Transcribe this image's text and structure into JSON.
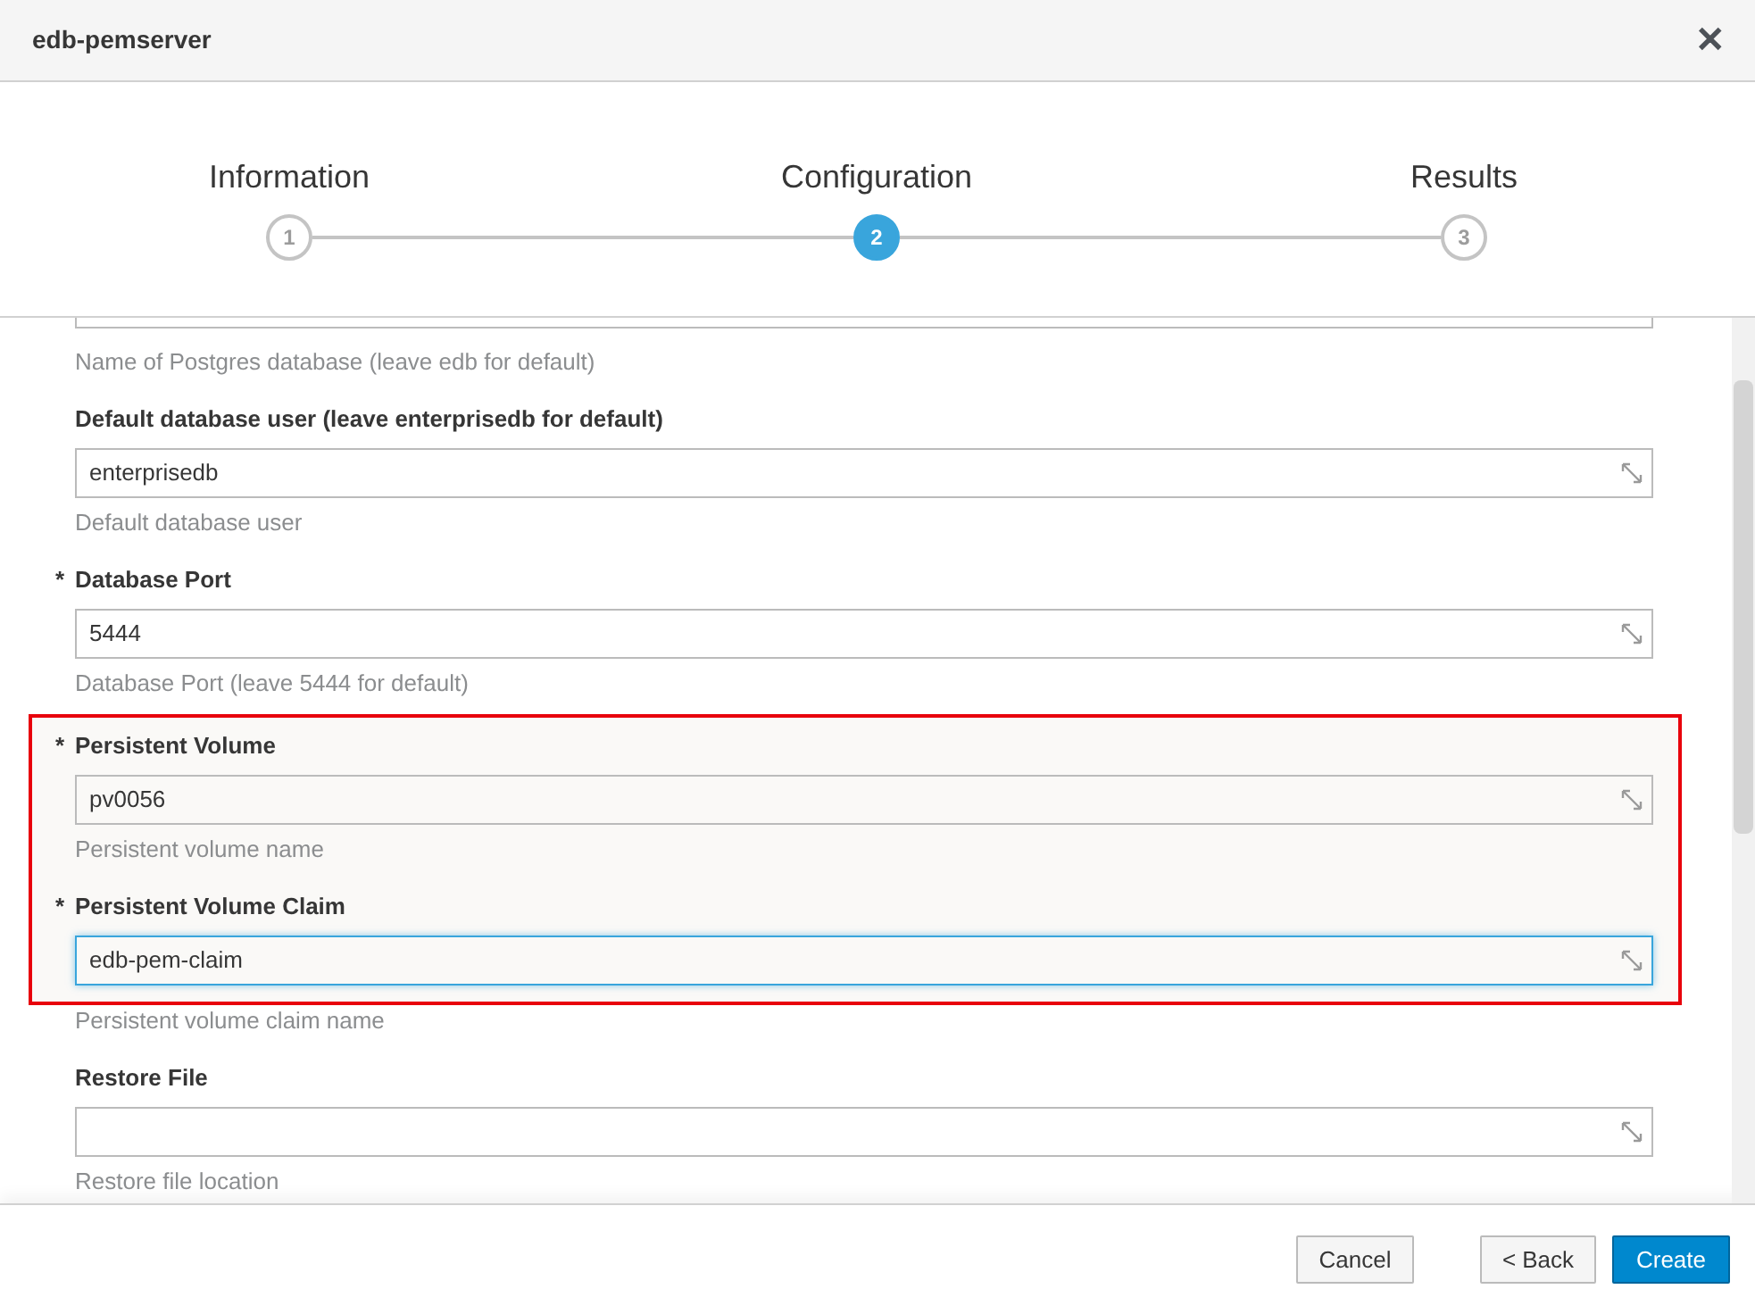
{
  "window": {
    "title": "edb-pemserver",
    "close": "✕"
  },
  "steps": [
    {
      "label": "Information",
      "number": "1",
      "selected": false
    },
    {
      "label": "Configuration",
      "number": "2",
      "selected": true
    },
    {
      "label": "Results",
      "number": "3",
      "selected": false
    }
  ],
  "form": [
    {
      "kind": "partial",
      "help": "Name of Postgres database (leave edb for default)"
    },
    {
      "kind": "field",
      "label": "Default database user (leave enterprisedb for default)",
      "value": "enterprisedb",
      "help": "Default database user",
      "focused": false
    },
    {
      "kind": "field",
      "marker": "*",
      "label": "Database Port",
      "value": "5444",
      "help": "Database Port (leave 5444 for default)",
      "focused": false
    },
    {
      "kind": "highlight",
      "fields": [
        {
          "kind": "field",
          "marker": "*",
          "label": "Persistent Volume",
          "value": "pv0056",
          "help": "Persistent volume name",
          "focused": false
        },
        {
          "kind": "field",
          "marker": "*",
          "label": "Persistent Volume Claim",
          "value": "edb-pem-claim",
          "focused": true
        }
      ],
      "help_after": "Persistent volume claim name"
    },
    {
      "kind": "field",
      "label": "Restore File",
      "help": "Restore file location",
      "focused": false
    }
  ],
  "footer": {
    "cancel": "Cancel",
    "back": "< Back",
    "create": "Create"
  }
}
